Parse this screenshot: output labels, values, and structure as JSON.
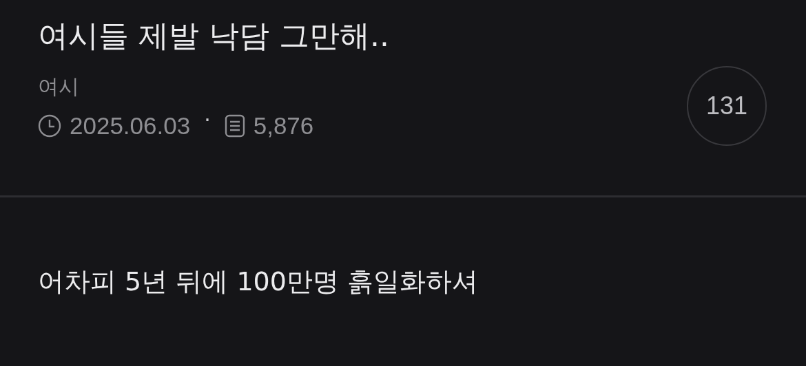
{
  "post": {
    "title": "여시들 제발 낙담 그만해..",
    "author": "여시",
    "date": "2025.06.03",
    "separator": "·",
    "views": "5,876",
    "comment_count": "131"
  },
  "body": {
    "text": "어차피 5년 뒤에 100만명 흙일화하셔"
  }
}
